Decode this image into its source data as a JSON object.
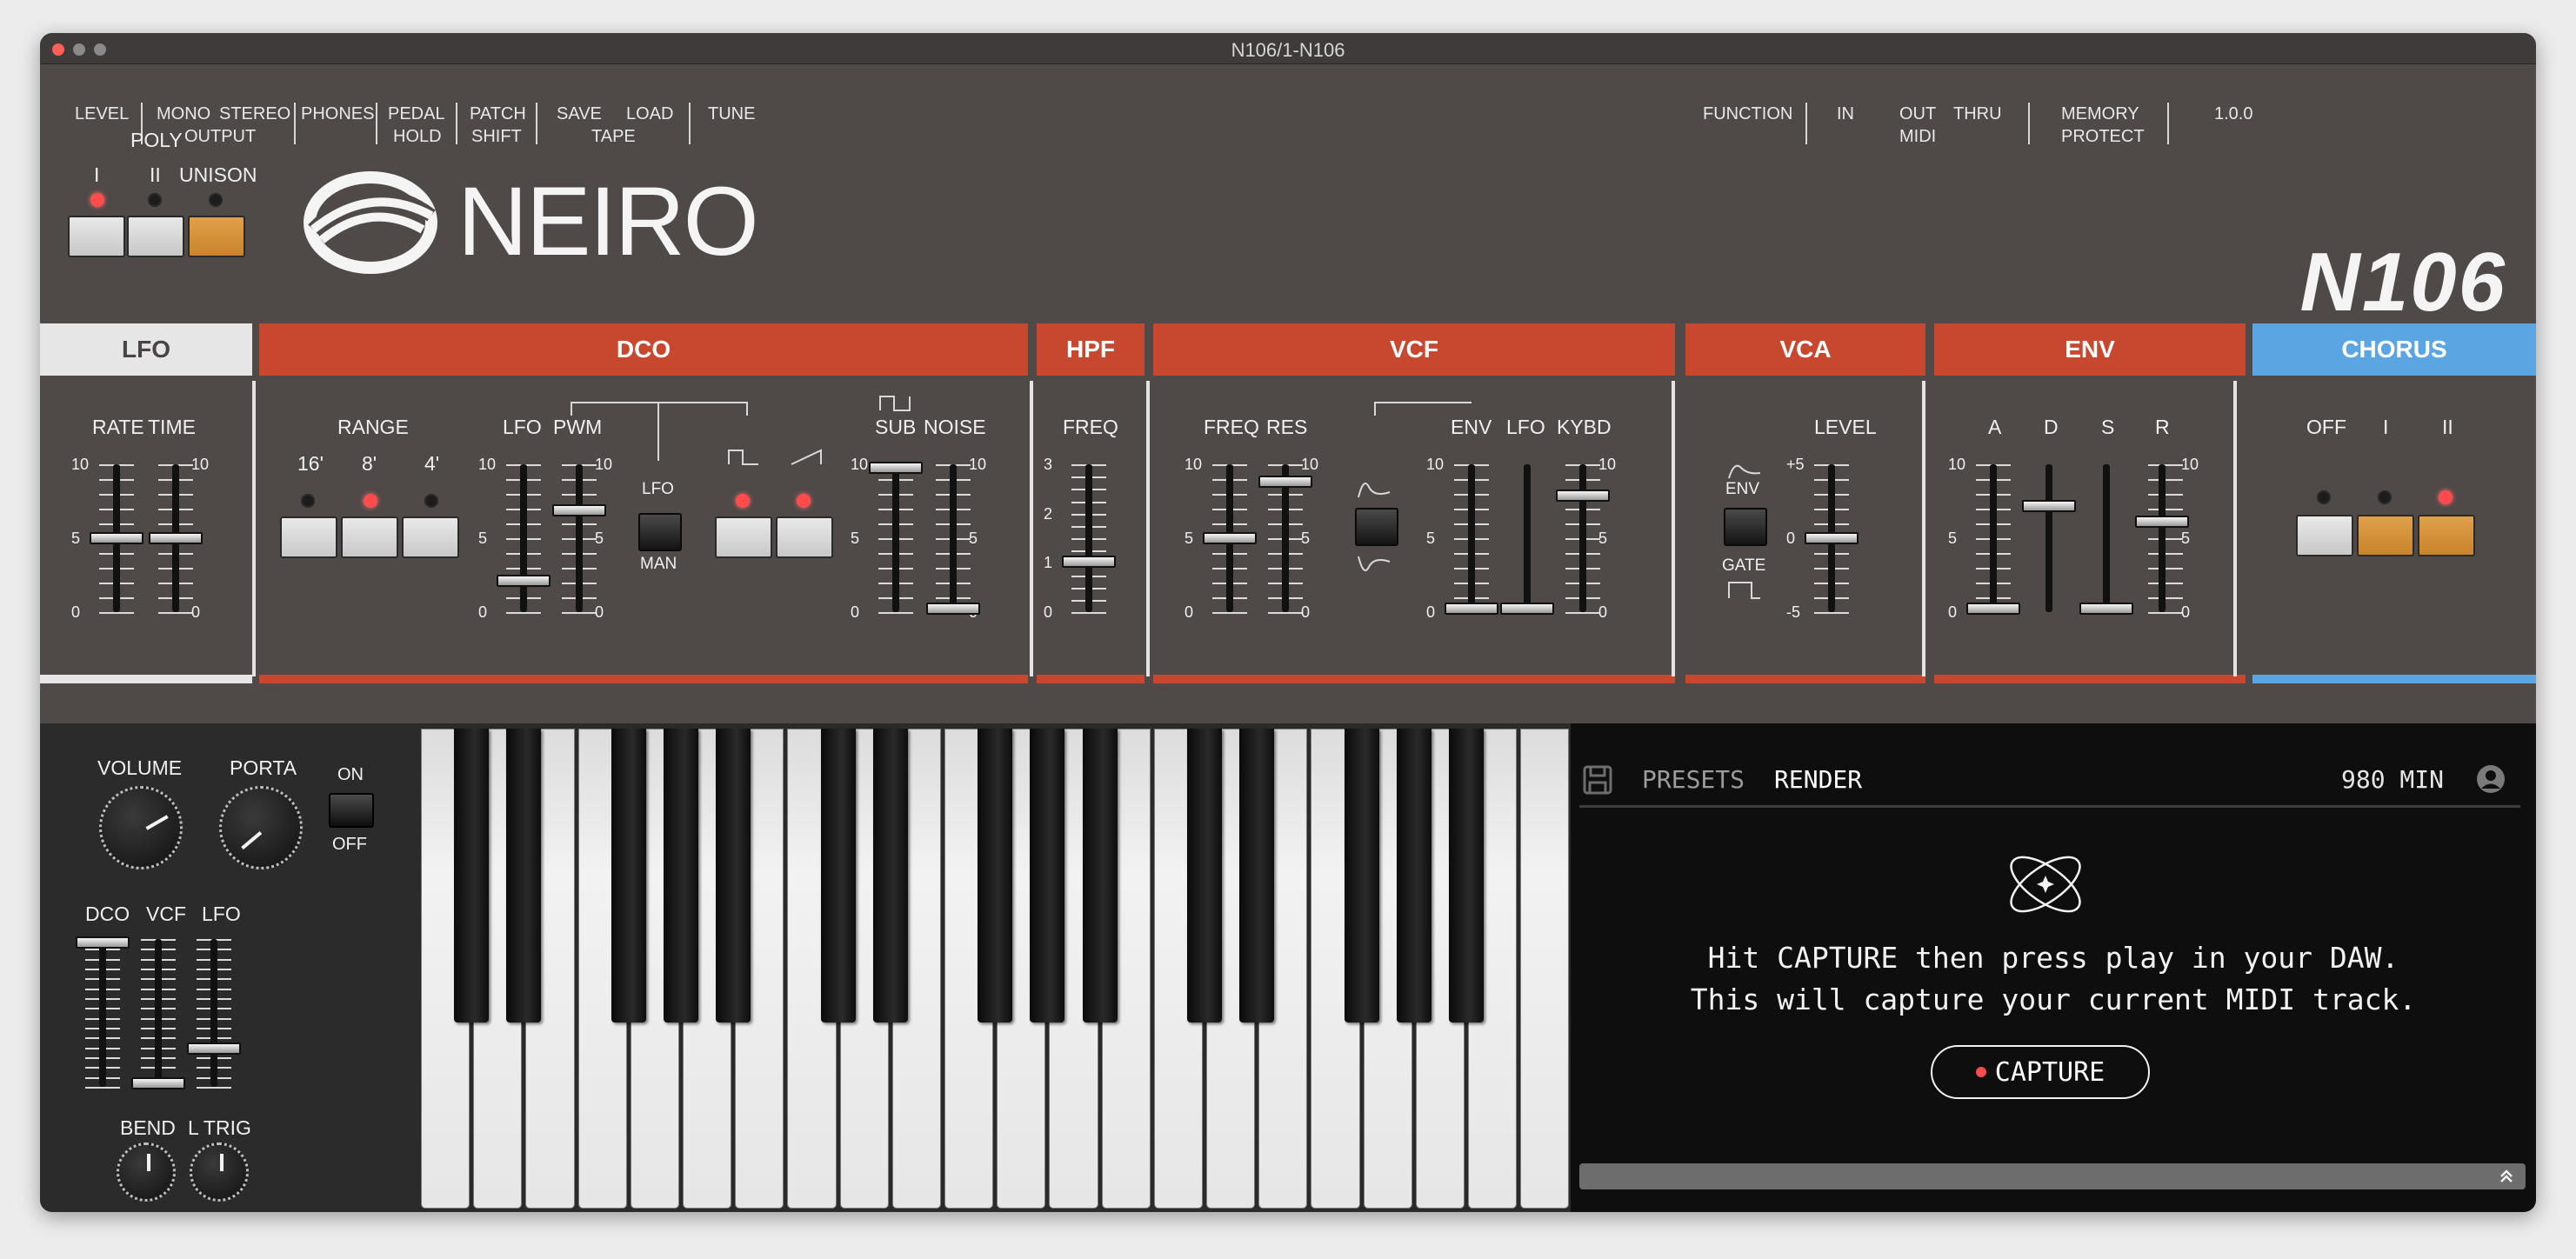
{
  "window": {
    "title": "N106/1-N106"
  },
  "toolbar": {
    "level": "LEVEL",
    "mono": "MONO",
    "stereo": "STEREO",
    "output": "OUTPUT",
    "phones": "PHONES",
    "pedal": "PEDAL",
    "hold": "HOLD",
    "patch": "PATCH",
    "shift": "SHIFT",
    "save": "SAVE",
    "load": "LOAD",
    "tape": "TAPE",
    "tune": "TUNE",
    "function": "FUNCTION",
    "in": "IN",
    "out": "OUT",
    "thru": "THRU",
    "midi": "MIDI",
    "memory": "MEMORY",
    "protect": "PROTECT",
    "version": "1.0.0"
  },
  "poly": {
    "title": "POLY",
    "i": "I",
    "ii": "II",
    "unison": "UNISON"
  },
  "brand": {
    "logo": "NEIRO",
    "model": "N106"
  },
  "sections": {
    "lfo": "LFO",
    "dco": "DCO",
    "hpf": "HPF",
    "vcf": "VCF",
    "vca": "VCA",
    "env": "ENV",
    "chorus": "CHORUS",
    "colors": {
      "lfo": "#e6e6e6",
      "red": "#c8472f",
      "chorus": "#5aa5e2"
    }
  },
  "lfo": {
    "rate": "RATE",
    "time": "TIME",
    "rate_value": 0.5,
    "time_value": 0.5
  },
  "dco": {
    "range": "RANGE",
    "r16": "16'",
    "r8": "8'",
    "r4": "4'",
    "lfo": "LFO",
    "pwm": "PWM",
    "lfo_switch": "LFO",
    "man_switch": "MAN",
    "sub": "SUB",
    "noise": "NOISE",
    "lfo_value": 0.2,
    "pwm_value": 0.7,
    "sub_value": 1.0,
    "noise_value": 0.0
  },
  "hpf": {
    "freq": "FREQ",
    "value": 1
  },
  "vcf": {
    "freq": "FREQ",
    "res": "RES",
    "env": "ENV",
    "lfo": "LFO",
    "kybd": "KYBD",
    "freq_value": 0.5,
    "res_value": 0.9,
    "env_value": 0.0,
    "lfo_value": 0.0,
    "kybd_value": 0.8
  },
  "vca": {
    "level": "LEVEL",
    "env": "ENV",
    "gate": "GATE",
    "level_value": 0
  },
  "envelope": {
    "a": "A",
    "d": "D",
    "s": "S",
    "r": "R",
    "a_value": 0.0,
    "d_value": 0.73,
    "s_value": 0.0,
    "r_value": 0.62
  },
  "chorus": {
    "off": "OFF",
    "i": "I",
    "ii": "II"
  },
  "scale": {
    "ten": "10",
    "five": "5",
    "zero": "0",
    "three": "3",
    "two": "2",
    "one": "1",
    "plus5": "+5",
    "minus5": "-5"
  },
  "perf": {
    "volume": "VOLUME",
    "porta": "PORTA",
    "on": "ON",
    "off": "OFF",
    "dco": "DCO",
    "vcf": "VCF",
    "lfo": "LFO",
    "bend": "BEND",
    "ltrig": "L TRIG"
  },
  "render": {
    "presets": "PRESETS",
    "render": "RENDER",
    "minutes": "980 MIN",
    "line1": "Hit CAPTURE then press play in your DAW.",
    "line2": "This will capture your current MIDI track.",
    "capture": "CAPTURE"
  }
}
